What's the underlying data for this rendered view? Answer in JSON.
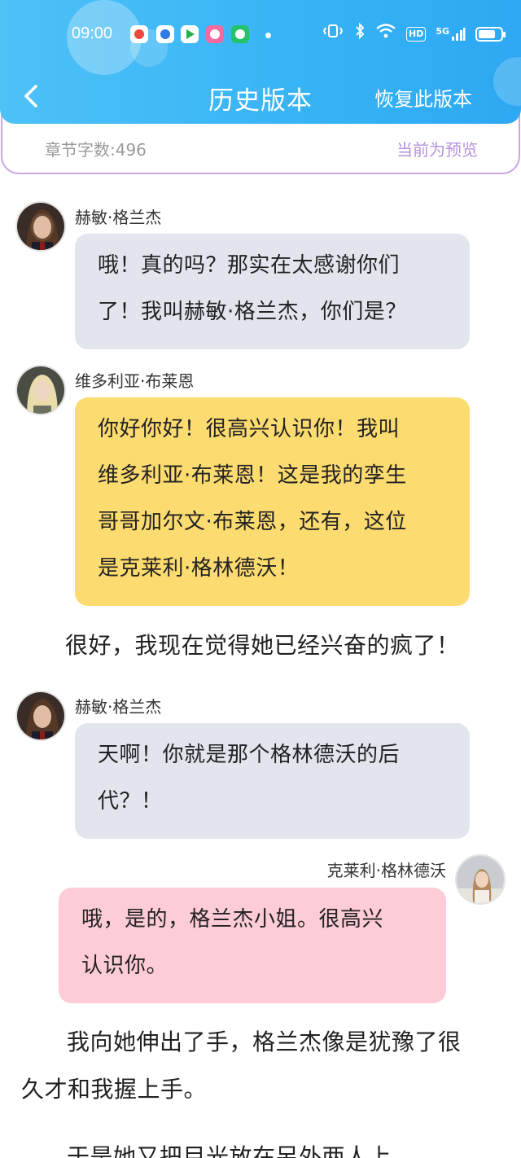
{
  "status_bar": {
    "time": "09:00",
    "network": "5G",
    "hd_label": "HD"
  },
  "nav": {
    "title": "历史版本",
    "restore_label": "恢复此版本"
  },
  "info": {
    "word_count": "章节字数:496",
    "preview_label": "当前为预览"
  },
  "colors": {
    "header": "#36b3f5",
    "accent_purple": "#b792dd",
    "bubble_gray": "#e2e5ed",
    "bubble_yellow": "#fcdb70",
    "bubble_pink": "#fdccd6"
  },
  "chat": [
    {
      "type": "message",
      "speaker": "赫敏·格兰杰",
      "side": "left",
      "color": "gray",
      "lines": [
        "哦！真的吗？那实在太感谢你们",
        "了！我叫赫敏·格兰杰，你们是？"
      ]
    },
    {
      "type": "message",
      "speaker": "维多利亚·布莱恩",
      "side": "left",
      "color": "yellow",
      "lines": [
        "你好你好！很高兴认识你！我叫",
        "维多利亚·布莱恩！这是我的孪生",
        "哥哥加尔文·布莱恩，还有，这位",
        "是克莱利·格林德沃！"
      ]
    },
    {
      "type": "narration",
      "lines": [
        "很好，我现在觉得她已经兴奋的疯了！"
      ]
    },
    {
      "type": "message",
      "speaker": "赫敏·格兰杰",
      "side": "left",
      "color": "gray",
      "lines": [
        "天啊！你就是那个格林德沃的后",
        "代？！"
      ]
    },
    {
      "type": "message",
      "speaker": "克莱利·格林德沃",
      "side": "right",
      "color": "pink",
      "lines": [
        "哦，是的，格兰杰小姐。很高兴",
        "认识你。"
      ]
    },
    {
      "type": "narration",
      "lines": [
        "我向她伸出了手，格兰杰像是犹豫了很",
        "久才和我握上手。"
      ]
    },
    {
      "type": "narration",
      "lines": [
        "于是她又把目光放在另外两人上"
      ]
    }
  ]
}
